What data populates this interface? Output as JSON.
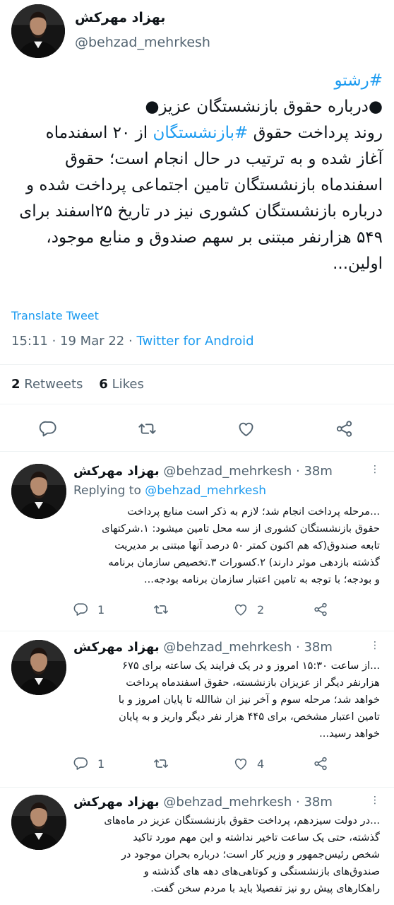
{
  "main_tweet": {
    "author_name": "بهزاد مهرکش",
    "author_handle": "@behzad_mehrkesh",
    "body_lines": [
      {
        "hashtag": "#رشتو",
        "text": ""
      },
      {
        "hashtag": "",
        "text": "●درباره حقوق بازنشستگان عزیز●"
      },
      {
        "hashtag": "",
        "text": "روند پرداخت حقوق #بازنشستگان از ۲۰ اسفندماه"
      },
      {
        "hashtag": "",
        "text": "آغاز شده و به ترتیب در حال انجام است؛ حقوق"
      },
      {
        "hashtag": "",
        "text": "اسفندماه بازنشستگان تامین اجتماعی پرداخت شده و"
      },
      {
        "hashtag": "",
        "text": "درباره بازنشستگان کشوری نیز در تاریخ ۲۵اسفند برای"
      },
      {
        "hashtag": "",
        "text": "۵۴۹ هزارنفر مبتنی بر سهم صندوق و منابع موجود،"
      },
      {
        "hashtag": "",
        "text": "اولین..."
      }
    ],
    "line2_parts": {
      "before": "روند پرداخت حقوق ",
      "hashtag": "#بازنشستگان",
      "after": " از ۲۰ اسفندماه"
    },
    "translate_label": "Translate Tweet",
    "time": "15:11",
    "date": "19 Mar 22",
    "source": "Twitter for Android",
    "retweets_count": "2",
    "retweets_label": "Retweets",
    "likes_count": "6",
    "likes_label": "Likes"
  },
  "replies": [
    {
      "author_name": "بهزاد مهرکش",
      "author_handle": "@behzad_mehrkesh",
      "age": "38m",
      "replying_label": "Replying to",
      "replying_to": "@behzad_mehrkesh",
      "lines": [
        "...مرحله پرداخت انجام شد؛ لازم به ذکر است منابع پرداخت",
        "حقوق بازنشستگان کشوری از سه محل تامین میشود: ۱.شرکتهای",
        "تابعه صندوق(که هم اکنون کمتر ۵۰ درصد آنها مبتنی بر مدیریت",
        "گذشته بازدهی موثر دارند) ۲.کسورات ۳.تخصیص سازمان برنامه",
        "و بودجه؛ با توجه به تامین اعتبار سازمان برنامه بودجه..."
      ],
      "reply_count": "1",
      "like_count": "2"
    },
    {
      "author_name": "بهزاد مهرکش",
      "author_handle": "@behzad_mehrkesh",
      "age": "38m",
      "lines": [
        "...از ساعت ۱۵:۳۰ امروز و در یک فرایند یک ساعته برای ۶۷۵",
        "هزارنفر دیگر از عزیزان بازنشسته، حقوق اسفندماه پرداخت",
        "خواهد شد؛ مرحله سوم و آخر نیز ان شاالله تا پایان امروز و با",
        "تامین اعتبار مشخص، برای ۴۴۵ هزار نفر دیگر واریز و به پایان",
        "خواهد رسید..."
      ],
      "reply_count": "1",
      "like_count": "4"
    },
    {
      "author_name": "بهزاد مهرکش",
      "author_handle": "@behzad_mehrkesh",
      "age": "38m",
      "lines": [
        "...در دولت سیزدهم، پرداخت حقوق بازنشستگان عزیز در ماه‌های",
        "گذشته، حتی یک ساعت تاخیر نداشته و این مهم مورد تاکید",
        "شخص رئیس‌جمهور و وزیر کار است؛ درباره بحران موجود در",
        "صندوق‌های بازنشستگی و کوتاهی‌های دهه های گذشته و",
        "راهکارهای پیش رو نیز تفصیلا باید با مردم سخن گفت."
      ]
    }
  ],
  "icons": {
    "reply": "comment-icon",
    "retweet": "retweet-icon",
    "like": "heart-icon",
    "share": "share-icon",
    "more": "more-dots-icon"
  },
  "colors": {
    "accent": "#1d9bf0",
    "text": "#0f1419",
    "muted": "#536471",
    "divider": "#eff3f4"
  }
}
